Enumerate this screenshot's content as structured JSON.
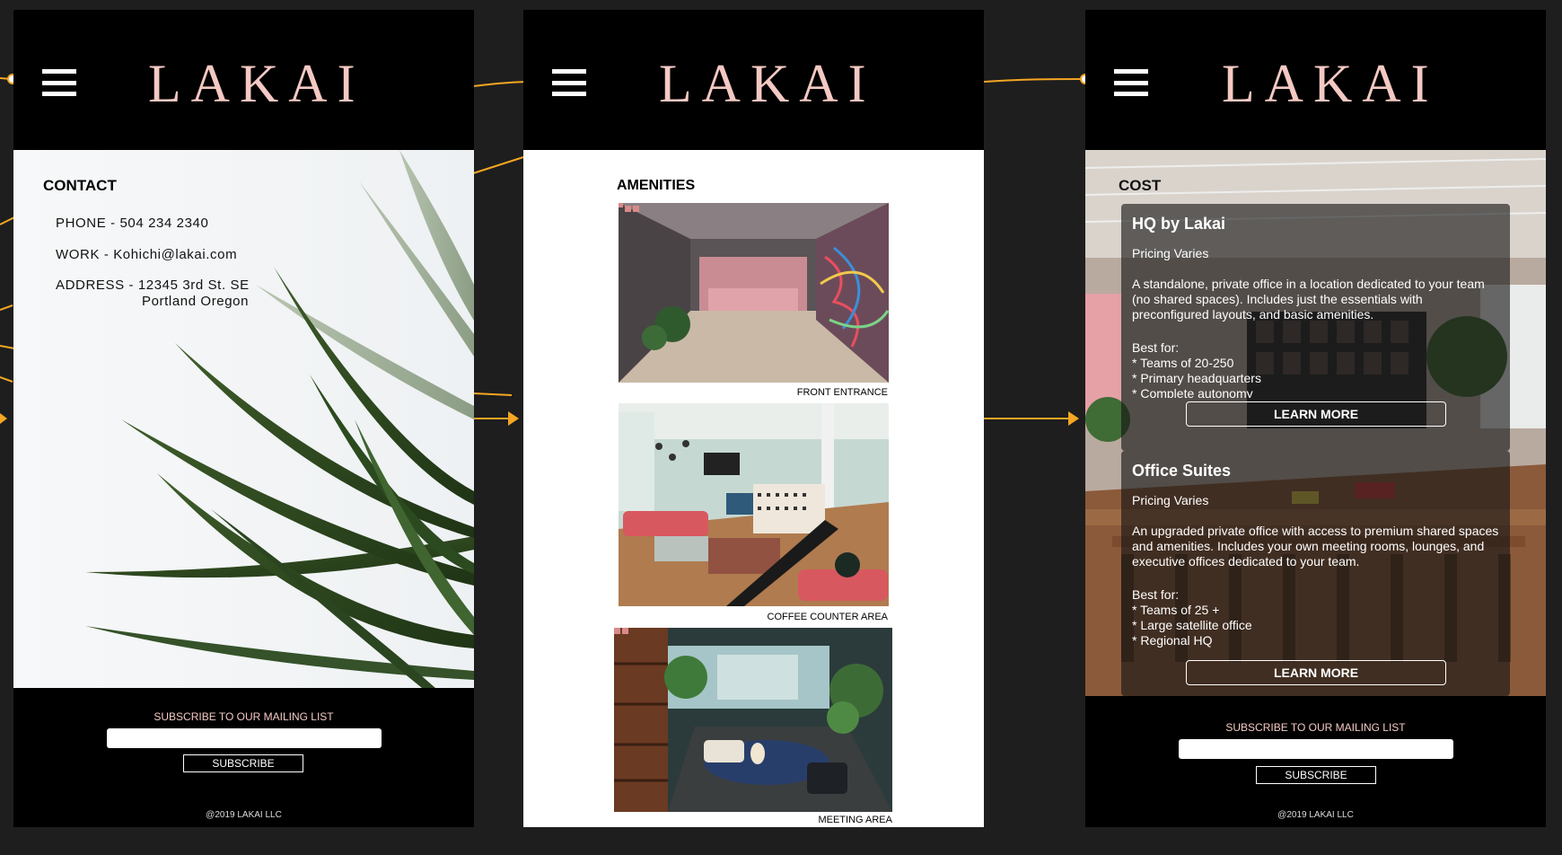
{
  "brand": {
    "logo": "LAKAI",
    "logo_color": "#f4c9c3"
  },
  "contact_screen": {
    "title": "CONTACT",
    "phone": "PHONE - 504 234 2340",
    "work": "WORK - Kohichi@lakai.com",
    "address_line1": "ADDRESS - 12345 3rd St. SE",
    "address_line2": "Portland Oregon",
    "subscribe_label": "SUBSCRIBE TO OUR MAILING LIST",
    "subscribe_button": "SUBSCRIBE",
    "copyright": "@2019 LAKAI LLC"
  },
  "amenities_screen": {
    "title": "AMENITIES",
    "photos": [
      {
        "caption": "FRONT ENTRANCE"
      },
      {
        "caption": "COFFEE COUNTER AREA"
      },
      {
        "caption": "MEETING  AREA"
      }
    ]
  },
  "cost_screen": {
    "title": "COST",
    "cards": [
      {
        "name": "HQ by Lakai",
        "price": "Pricing Varies",
        "description": "A standalone, private office in a location dedicated to your team (no shared spaces). Includes just the essentials with preconfigured layouts, and basic amenities.",
        "best_for_label": "Best for:",
        "best_for": [
          "* Teams of 20-250",
          "* Primary headquarters",
          "* Complete autonomy"
        ],
        "button": "LEARN MORE"
      },
      {
        "name": "Office Suites",
        "price": "Pricing Varies",
        "description": "An upgraded private office with access to premium shared spaces and amenities. Includes your own meeting rooms, lounges, and executive offices dedicated to your team.",
        "best_for_label": "Best for:",
        "best_for": [
          "* Teams of 25 +",
          "* Large satellite office",
          "* Regional HQ"
        ],
        "button": "LEARN MORE"
      }
    ],
    "subscribe_label": "SUBSCRIBE TO OUR MAILING LIST",
    "subscribe_button": "SUBSCRIBE",
    "copyright": "@2019 LAKAI LLC"
  },
  "colors": {
    "canvas": "#1e1e1e",
    "prototype_wire": "#f5a623",
    "accent_pink": "#f4c9c3"
  }
}
